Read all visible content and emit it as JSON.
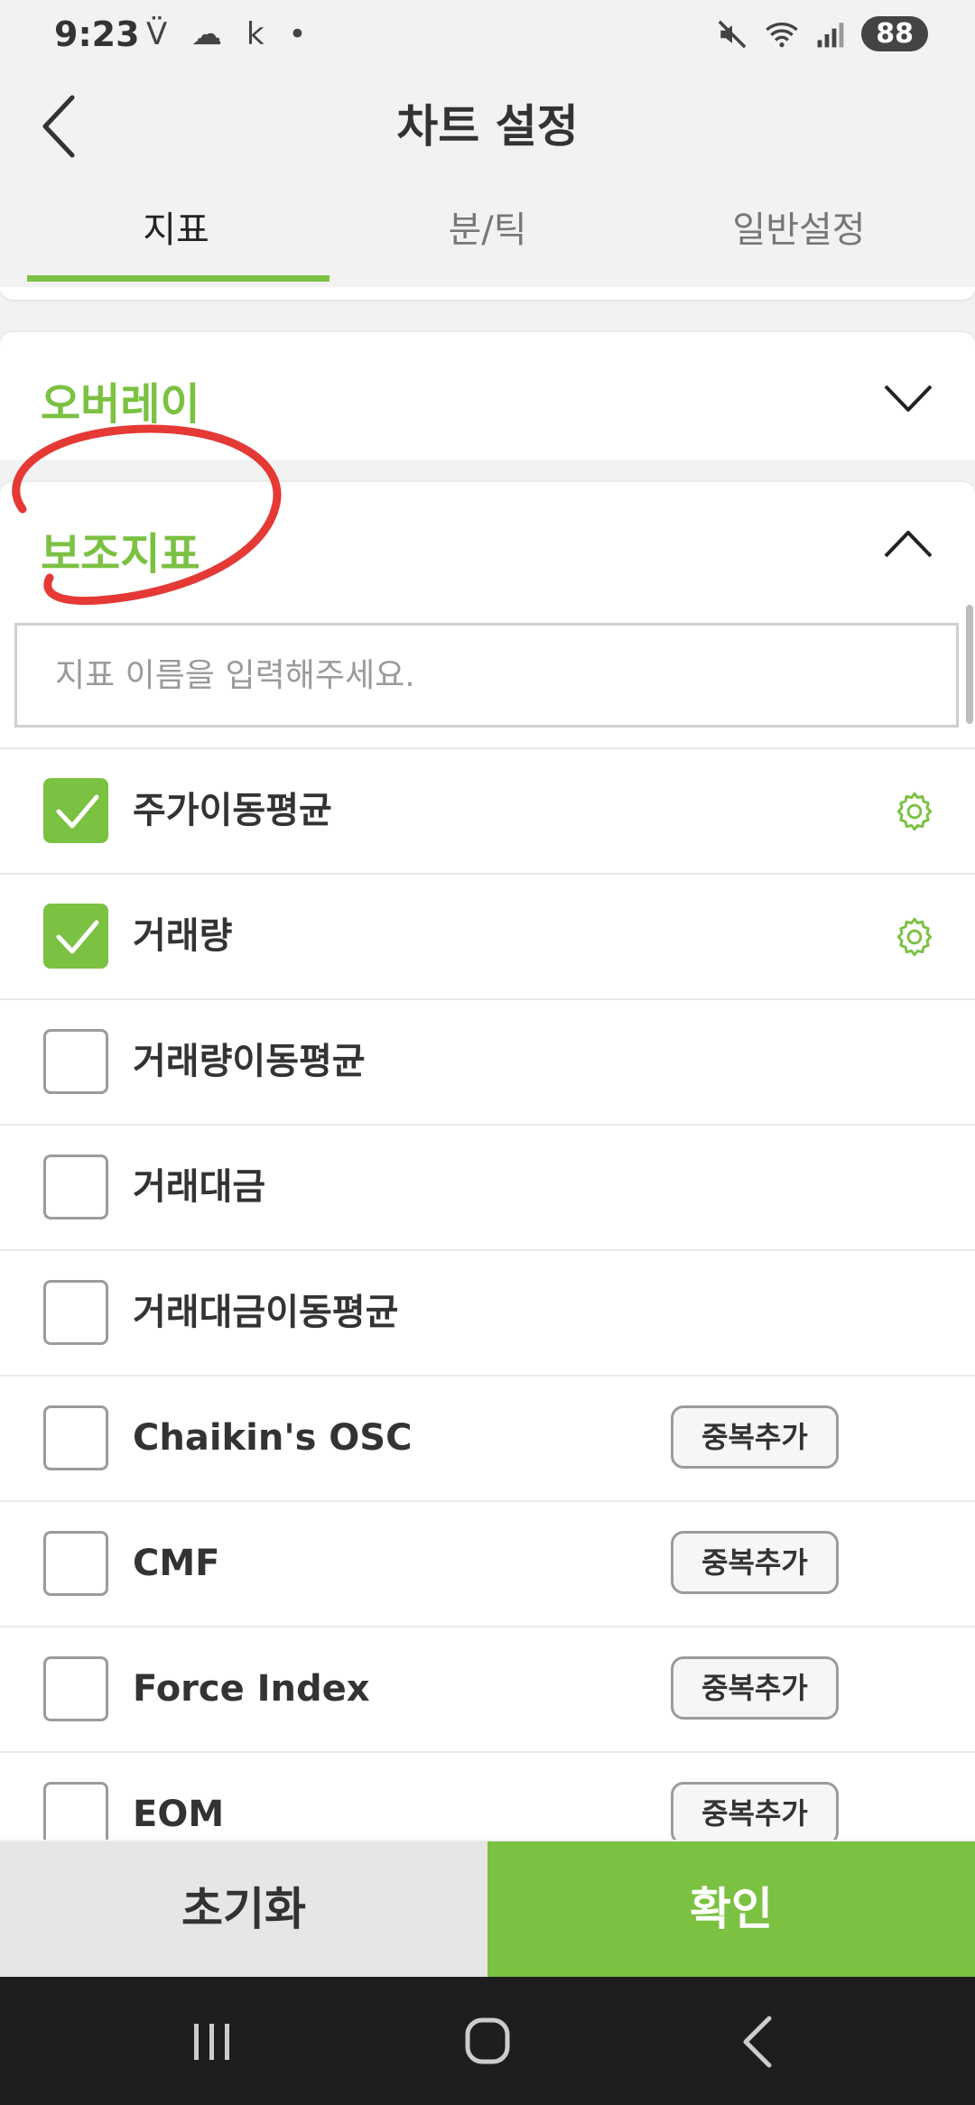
{
  "status": {
    "time": "9:23",
    "left_icons": "V̈ ☁ k •",
    "battery": "88"
  },
  "header": {
    "title": "차트 설정"
  },
  "tabs": [
    {
      "label": "지표"
    },
    {
      "label": "분/틱"
    },
    {
      "label": "일반설정"
    }
  ],
  "sections": {
    "overlay": {
      "title": "오버레이"
    },
    "sub_indicators": {
      "title": "보조지표"
    }
  },
  "search": {
    "placeholder": "지표 이름을 입력해주세요."
  },
  "indicators": [
    {
      "label": "주가이동평균",
      "checked": true,
      "action": "gear"
    },
    {
      "label": "거래량",
      "checked": true,
      "action": "gear"
    },
    {
      "label": "거래량이동평균",
      "checked": false,
      "action": ""
    },
    {
      "label": "거래대금",
      "checked": false,
      "action": ""
    },
    {
      "label": "거래대금이동평균",
      "checked": false,
      "action": ""
    },
    {
      "label": "Chaikin's OSC",
      "checked": false,
      "action": "dup"
    },
    {
      "label": "CMF",
      "checked": false,
      "action": "dup"
    },
    {
      "label": "Force Index",
      "checked": false,
      "action": "dup"
    },
    {
      "label": "EOM",
      "checked": false,
      "action": "dup"
    }
  ],
  "dup_label": "중복추가",
  "footer": {
    "reset": "초기화",
    "confirm": "확인"
  },
  "colors": {
    "accent": "#7bc142",
    "annotation": "#e53935"
  }
}
